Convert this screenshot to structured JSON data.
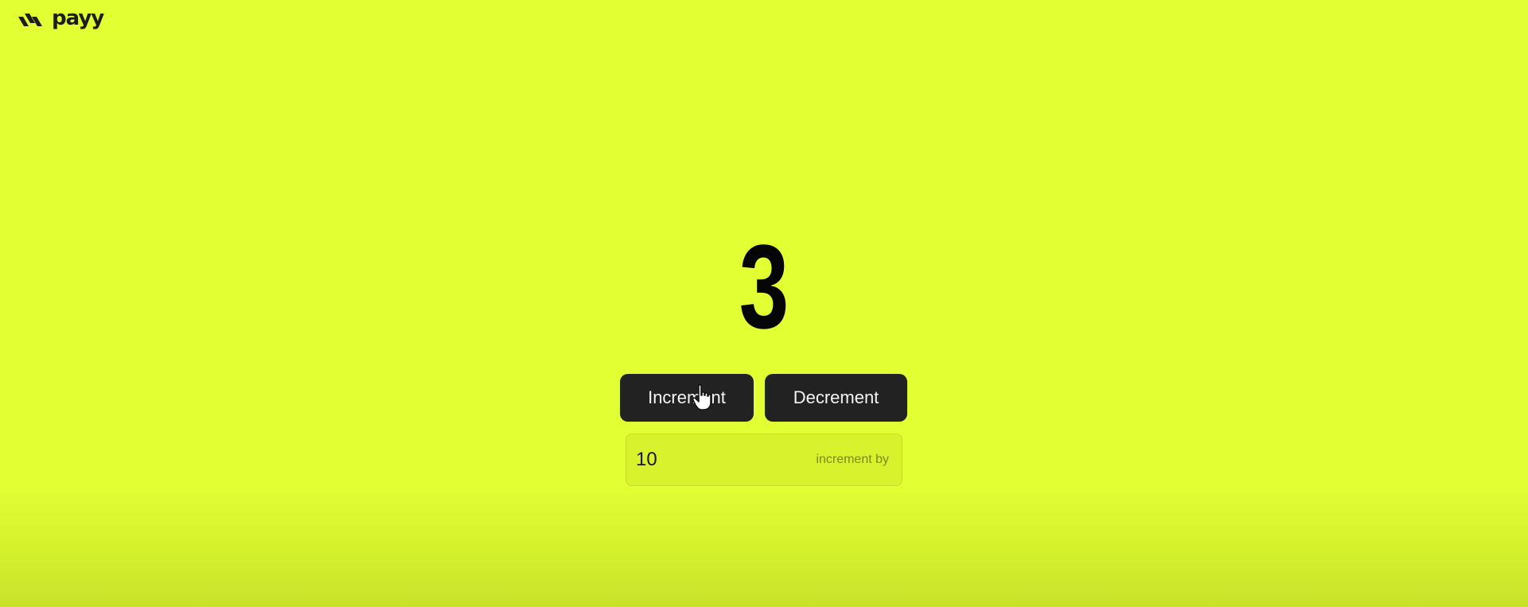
{
  "brand": {
    "name": "payy",
    "logo_icon": "payy-logo-icon"
  },
  "counter": {
    "value": "3"
  },
  "buttons": {
    "increment_label": "Increment",
    "decrement_label": "Decrement"
  },
  "increment_input": {
    "value": "10",
    "hint": "increment by"
  },
  "cursor": {
    "icon": "hand-pointer-icon"
  },
  "colors": {
    "background": "#e1ff33",
    "button_bg": "#222222",
    "button_text": "#f4f4f4",
    "counter_text": "#050505"
  }
}
